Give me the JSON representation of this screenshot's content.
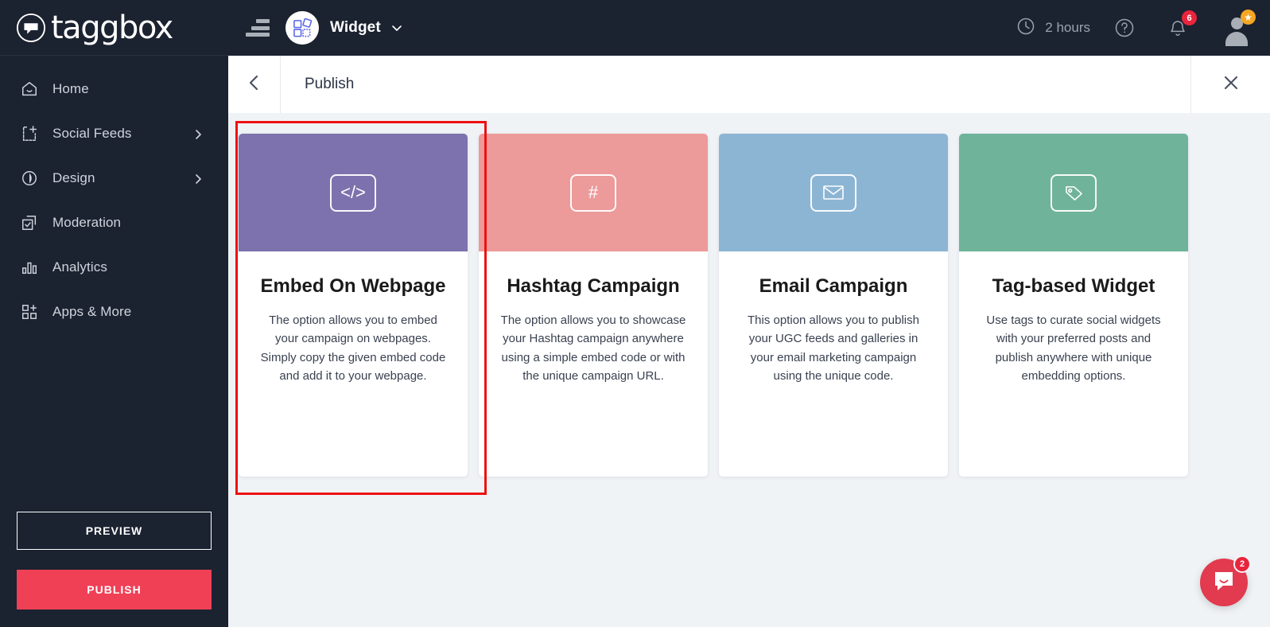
{
  "brand": {
    "name": "taggbox",
    "logo_icon": "taggbox-speech-bubble-logo"
  },
  "sidebar": {
    "items": [
      {
        "label": "Home",
        "icon": "home-icon",
        "chevron": false
      },
      {
        "label": "Social Feeds",
        "icon": "feed-add-icon",
        "chevron": true
      },
      {
        "label": "Design",
        "icon": "droplet-icon",
        "chevron": true
      },
      {
        "label": "Moderation",
        "icon": "moderation-check-icon",
        "chevron": false
      },
      {
        "label": "Analytics",
        "icon": "bar-chart-icon",
        "chevron": false
      },
      {
        "label": "Apps & More",
        "icon": "apps-grid-icon",
        "chevron": false
      }
    ],
    "preview_label": "PREVIEW",
    "publish_label": "PUBLISH",
    "publish_color": "#ef4056",
    "background": "#1b2230"
  },
  "topbar": {
    "menu_icon": "hamburger-menu-icon",
    "widget_icon": "widget-squares-icon",
    "widget_name": "Widget",
    "widget_caret_icon": "chevron-down-icon",
    "time_icon": "clock-icon",
    "time_label": "2 hours",
    "help_icon": "help-circle-icon",
    "notifications_icon": "bell-icon",
    "notifications_count": "6",
    "avatar_icon": "user-avatar",
    "avatar_badge_icon": "star-icon"
  },
  "page": {
    "back_icon": "chevron-left-icon",
    "title": "Publish",
    "close_icon": "close-icon"
  },
  "cards": [
    {
      "id": "embed-on-webpage",
      "title": "Embed On Webpage",
      "description": "The option allows you to embed your campaign on webpages. Simply copy the given embed code and add it to your webpage.",
      "icon": "code-icon",
      "glyph": "</>",
      "header_color": "#7d72ae",
      "selected": true
    },
    {
      "id": "hashtag-campaign",
      "title": "Hashtag Campaign",
      "description": "The option allows you to showcase your Hashtag campaign anywhere using a simple embed code or with the unique campaign URL.",
      "icon": "hashtag-icon",
      "glyph": "#",
      "header_color": "#ec9a9a",
      "selected": false
    },
    {
      "id": "email-campaign",
      "title": "Email Campaign",
      "description": "This option allows you to publish your UGC feeds and galleries in your email marketing campaign using the unique code.",
      "icon": "envelope-icon",
      "glyph": "",
      "header_color": "#8cb5d4",
      "selected": false
    },
    {
      "id": "tag-based-widget",
      "title": "Tag-based Widget",
      "description": "Use tags to curate social widgets with your preferred posts and publish anywhere with unique embedding options.",
      "icon": "tag-icon",
      "glyph": "",
      "header_color": "#6fb39a",
      "selected": false
    }
  ],
  "chat": {
    "icon": "chat-bubble-icon",
    "unread_count": "2",
    "color": "#e23a4e"
  },
  "selection": {
    "color": "#ee1111"
  }
}
